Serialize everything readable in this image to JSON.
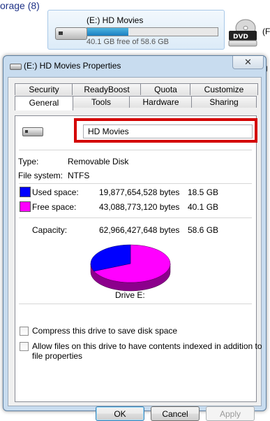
{
  "explorer": {
    "section_header": "orage (8)",
    "drive_tile": {
      "name": "(E:) HD Movies",
      "free_text": "40.1 GB free of 58.6 GB",
      "used_fraction": 0.316
    },
    "dvd_icon_label": "DVD",
    "dvd_partial_label": "(F",
    "right_partial_text": "J"
  },
  "dialog": {
    "title": "(E:) HD Movies Properties",
    "close_label": "✕",
    "tabs_row1": [
      "Security",
      "ReadyBoost",
      "Quota",
      "Customize"
    ],
    "tabs_row2": [
      "General",
      "Tools",
      "Hardware",
      "Sharing"
    ],
    "active_tab": "General",
    "general": {
      "drive_name_value": "HD Movies",
      "type_label": "Type:",
      "type_value": "Removable Disk",
      "fs_label": "File system:",
      "fs_value": "NTFS",
      "used_label": "Used space:",
      "used_bytes": "19,877,654,528 bytes",
      "used_size": "18.5 GB",
      "free_label": "Free space:",
      "free_bytes": "43,088,773,120 bytes",
      "free_size": "40.1 GB",
      "capacity_label": "Capacity:",
      "capacity_bytes": "62,966,427,648 bytes",
      "capacity_size": "58.6 GB",
      "drive_label": "Drive E:",
      "compress_label": "Compress this drive to save disk space",
      "index_label_line1": "Allow files on this drive to have contents indexed in addition to",
      "index_label_line2": "file properties",
      "compress_checked": false,
      "index_checked": false
    },
    "buttons": {
      "ok": "OK",
      "cancel": "Cancel",
      "apply": "Apply"
    }
  },
  "colors": {
    "used": "#0000ff",
    "used_side": "#00008c",
    "free": "#ff00ff",
    "free_side": "#8c008c",
    "highlight_frame": "#d40000"
  }
}
